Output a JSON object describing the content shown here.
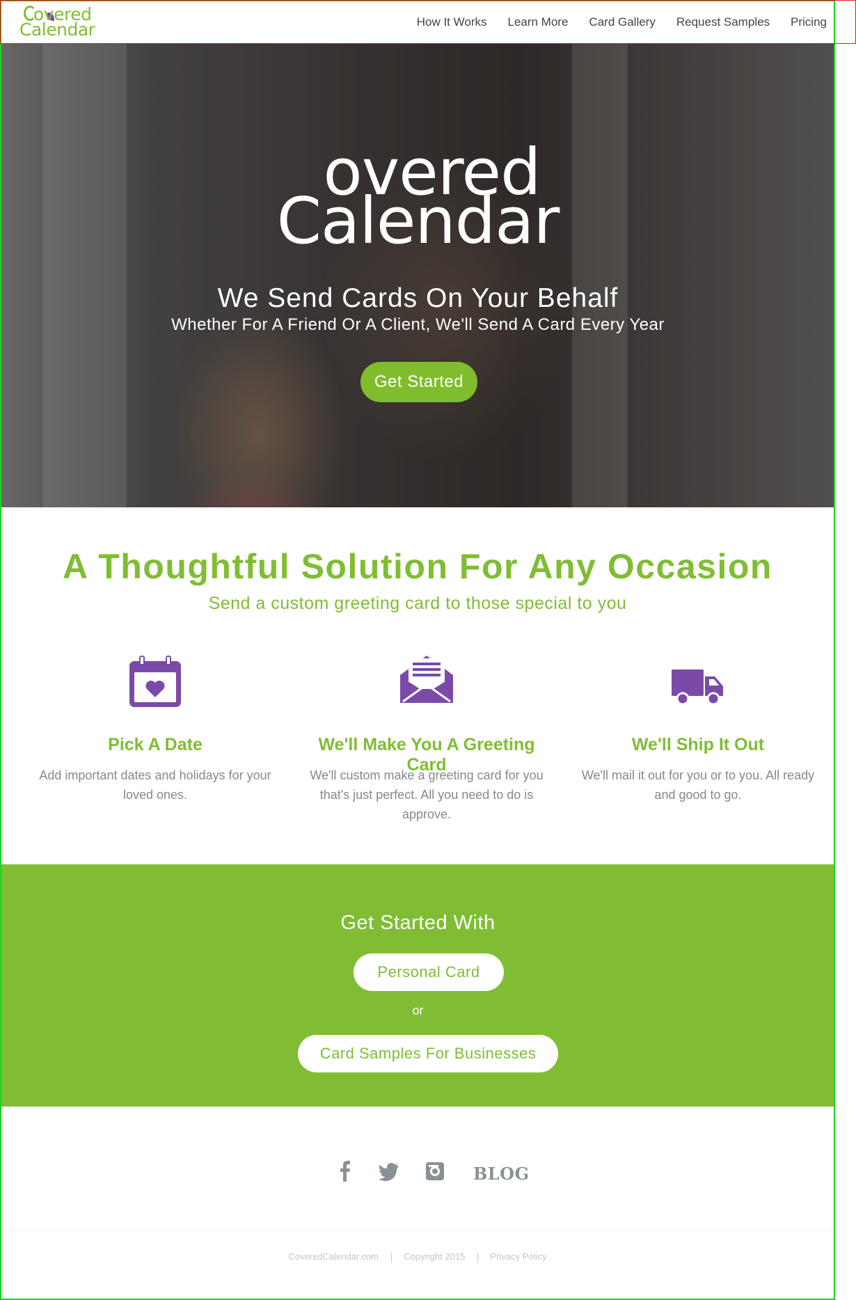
{
  "brand": {
    "logo_line1": "overed",
    "logo_line2": "Calendar",
    "accent_color": "#80bd34",
    "icon_color": "#7b4aa9"
  },
  "nav": {
    "items": [
      "How It Works",
      "Learn More",
      "Card Gallery",
      "Request Samples",
      "Pricing"
    ]
  },
  "hero": {
    "logo_line1": "overed",
    "logo_line2": "Calendar",
    "title": "We Send Cards On Your Behalf",
    "subtitle": "Whether For A Friend Or A Client, We'll Send A Card Every Year",
    "cta_label": "Get Started"
  },
  "solution": {
    "title": "A Thoughtful Solution For Any Occasion",
    "subtitle": "Send a custom greeting card to those special to you",
    "features": [
      {
        "icon": "calendar-heart-icon",
        "title": "Pick A Date",
        "text": "Add important dates and holidays for your loved ones."
      },
      {
        "icon": "envelope-letter-icon",
        "title": "We'll Make You A Greeting Card",
        "text": "We'll custom make a greeting card for you that's just perfect. All you need to do is approve."
      },
      {
        "icon": "truck-icon",
        "title": "We'll Ship It Out",
        "text": "We'll mail it out for you or to you. All ready and good to go."
      }
    ]
  },
  "cta": {
    "title": "Get Started With",
    "personal_label": "Personal Card",
    "or_label": "or",
    "business_label": "Card Samples For Businesses"
  },
  "social": {
    "icons": [
      "facebook-icon",
      "twitter-icon",
      "instagram-icon"
    ],
    "blog_label": "BLOG"
  },
  "footer": {
    "site": "CoveredCalendar.com",
    "copyright": "Copyright 2015",
    "privacy": "Privacy Policy"
  }
}
